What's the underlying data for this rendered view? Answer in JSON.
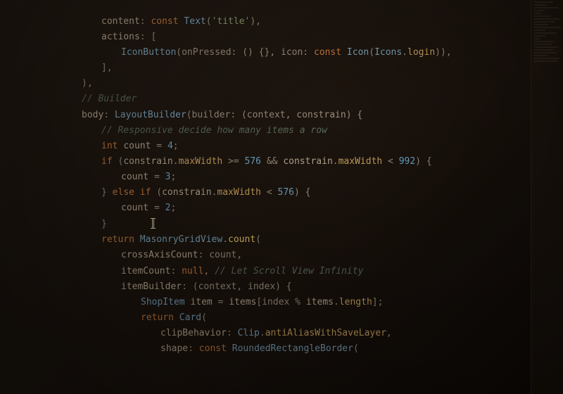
{
  "editor": {
    "language": "Dart",
    "cursor_line": 11,
    "lines": [
      {
        "indent": 3,
        "tokens": [
          {
            "t": "id",
            "v": "content"
          },
          {
            "t": "punct",
            "v": ": "
          },
          {
            "t": "kw",
            "v": "const"
          },
          {
            "t": "punct",
            "v": " "
          },
          {
            "t": "cls",
            "v": "Text"
          },
          {
            "t": "punct",
            "v": "("
          },
          {
            "t": "str",
            "v": "'title'"
          },
          {
            "t": "punct",
            "v": "),"
          }
        ]
      },
      {
        "indent": 3,
        "tokens": [
          {
            "t": "id",
            "v": "actions"
          },
          {
            "t": "punct",
            "v": ": ["
          }
        ]
      },
      {
        "indent": 4,
        "tokens": [
          {
            "t": "cls",
            "v": "IconButton"
          },
          {
            "t": "punct",
            "v": "(onPressed: () {}, icon: "
          },
          {
            "t": "kw",
            "v": "const"
          },
          {
            "t": "punct",
            "v": " "
          },
          {
            "t": "cls",
            "v": "Icon"
          },
          {
            "t": "punct",
            "v": "("
          },
          {
            "t": "cls",
            "v": "Icons"
          },
          {
            "t": "punct",
            "v": "."
          },
          {
            "t": "prop",
            "v": "login"
          },
          {
            "t": "punct",
            "v": ")),"
          }
        ]
      },
      {
        "indent": 3,
        "tokens": [
          {
            "t": "punct",
            "v": "],"
          }
        ]
      },
      {
        "indent": 2,
        "tokens": [
          {
            "t": "punct",
            "v": "),"
          }
        ]
      },
      {
        "indent": 2,
        "tokens": [
          {
            "t": "cmt",
            "v": "// Builder"
          }
        ]
      },
      {
        "indent": 2,
        "tokens": [
          {
            "t": "id",
            "v": "body"
          },
          {
            "t": "punct",
            "v": ": "
          },
          {
            "t": "cls",
            "v": "LayoutBuilder"
          },
          {
            "t": "punct",
            "v": "(builder: (context, constrain) {"
          }
        ]
      },
      {
        "indent": 3,
        "tokens": [
          {
            "t": "cmt",
            "v": "// Responsive decide how many items a row"
          }
        ]
      },
      {
        "indent": 3,
        "tokens": [
          {
            "t": "kw",
            "v": "int"
          },
          {
            "t": "punct",
            "v": " "
          },
          {
            "t": "id",
            "v": "count"
          },
          {
            "t": "punct",
            "v": " = "
          },
          {
            "t": "num",
            "v": "4"
          },
          {
            "t": "punct",
            "v": ";"
          }
        ]
      },
      {
        "indent": 3,
        "tokens": [
          {
            "t": "kw",
            "v": "if"
          },
          {
            "t": "punct",
            "v": " ("
          },
          {
            "t": "id",
            "v": "constrain"
          },
          {
            "t": "punct",
            "v": "."
          },
          {
            "t": "prop",
            "v": "maxWidth"
          },
          {
            "t": "punct",
            "v": " >= "
          },
          {
            "t": "num",
            "v": "576"
          },
          {
            "t": "punct",
            "v": " && "
          },
          {
            "t": "id",
            "v": "constrain"
          },
          {
            "t": "punct",
            "v": "."
          },
          {
            "t": "prop",
            "v": "maxWidth"
          },
          {
            "t": "punct",
            "v": " < "
          },
          {
            "t": "num",
            "v": "992"
          },
          {
            "t": "punct",
            "v": ") {"
          }
        ]
      },
      {
        "indent": 4,
        "tokens": [
          {
            "t": "id",
            "v": "count"
          },
          {
            "t": "punct",
            "v": " = "
          },
          {
            "t": "num",
            "v": "3"
          },
          {
            "t": "punct",
            "v": ";"
          }
        ]
      },
      {
        "indent": 3,
        "tokens": [
          {
            "t": "punct",
            "v": "} "
          },
          {
            "t": "kw",
            "v": "else if"
          },
          {
            "t": "punct",
            "v": " ("
          },
          {
            "t": "id",
            "v": "constrain"
          },
          {
            "t": "punct",
            "v": "."
          },
          {
            "t": "prop",
            "v": "maxWidth"
          },
          {
            "t": "punct",
            "v": " < "
          },
          {
            "t": "num",
            "v": "576"
          },
          {
            "t": "punct",
            "v": ") {"
          }
        ]
      },
      {
        "indent": 4,
        "tokens": [
          {
            "t": "id",
            "v": "count"
          },
          {
            "t": "punct",
            "v": " = "
          },
          {
            "t": "num",
            "v": "2"
          },
          {
            "t": "punct",
            "v": ";"
          }
        ]
      },
      {
        "indent": 3,
        "tokens": [
          {
            "t": "punct",
            "v": "}"
          }
        ],
        "cursor": true
      },
      {
        "indent": 3,
        "tokens": [
          {
            "t": "kw",
            "v": "return"
          },
          {
            "t": "punct",
            "v": " "
          },
          {
            "t": "cls",
            "v": "MasonryGridView"
          },
          {
            "t": "punct",
            "v": "."
          },
          {
            "t": "fn",
            "v": "count"
          },
          {
            "t": "punct",
            "v": "("
          }
        ]
      },
      {
        "indent": 4,
        "tokens": [
          {
            "t": "id",
            "v": "crossAxisCount"
          },
          {
            "t": "punct",
            "v": ": count,"
          }
        ]
      },
      {
        "indent": 4,
        "tokens": [
          {
            "t": "id",
            "v": "itemCount"
          },
          {
            "t": "punct",
            "v": ": "
          },
          {
            "t": "null",
            "v": "null"
          },
          {
            "t": "punct",
            "v": ", "
          },
          {
            "t": "cmt",
            "v": "// Let Scroll View Infinity"
          }
        ]
      },
      {
        "indent": 4,
        "tokens": [
          {
            "t": "id",
            "v": "itemBuilder"
          },
          {
            "t": "punct",
            "v": ": (context, index) {"
          }
        ]
      },
      {
        "indent": 5,
        "tokens": [
          {
            "t": "cls",
            "v": "ShopItem"
          },
          {
            "t": "punct",
            "v": " "
          },
          {
            "t": "id",
            "v": "item"
          },
          {
            "t": "punct",
            "v": " = "
          },
          {
            "t": "id",
            "v": "items"
          },
          {
            "t": "punct",
            "v": "[index % "
          },
          {
            "t": "id",
            "v": "items"
          },
          {
            "t": "punct",
            "v": "."
          },
          {
            "t": "prop",
            "v": "length"
          },
          {
            "t": "punct",
            "v": "];"
          }
        ]
      },
      {
        "indent": 5,
        "tokens": [
          {
            "t": "kw",
            "v": "return"
          },
          {
            "t": "punct",
            "v": " "
          },
          {
            "t": "cls",
            "v": "Card"
          },
          {
            "t": "punct",
            "v": "("
          }
        ]
      },
      {
        "indent": 6,
        "tokens": [
          {
            "t": "id",
            "v": "clipBehavior"
          },
          {
            "t": "punct",
            "v": ": "
          },
          {
            "t": "cls",
            "v": "Clip"
          },
          {
            "t": "punct",
            "v": "."
          },
          {
            "t": "prop",
            "v": "antiAliasWithSaveLayer"
          },
          {
            "t": "punct",
            "v": ","
          }
        ]
      },
      {
        "indent": 6,
        "tokens": [
          {
            "t": "id",
            "v": "shape"
          },
          {
            "t": "punct",
            "v": ": "
          },
          {
            "t": "kw",
            "v": "const"
          },
          {
            "t": "punct",
            "v": " "
          },
          {
            "t": "cls",
            "v": "RoundedRectangleBorder"
          },
          {
            "t": "punct",
            "v": "("
          }
        ]
      }
    ]
  }
}
